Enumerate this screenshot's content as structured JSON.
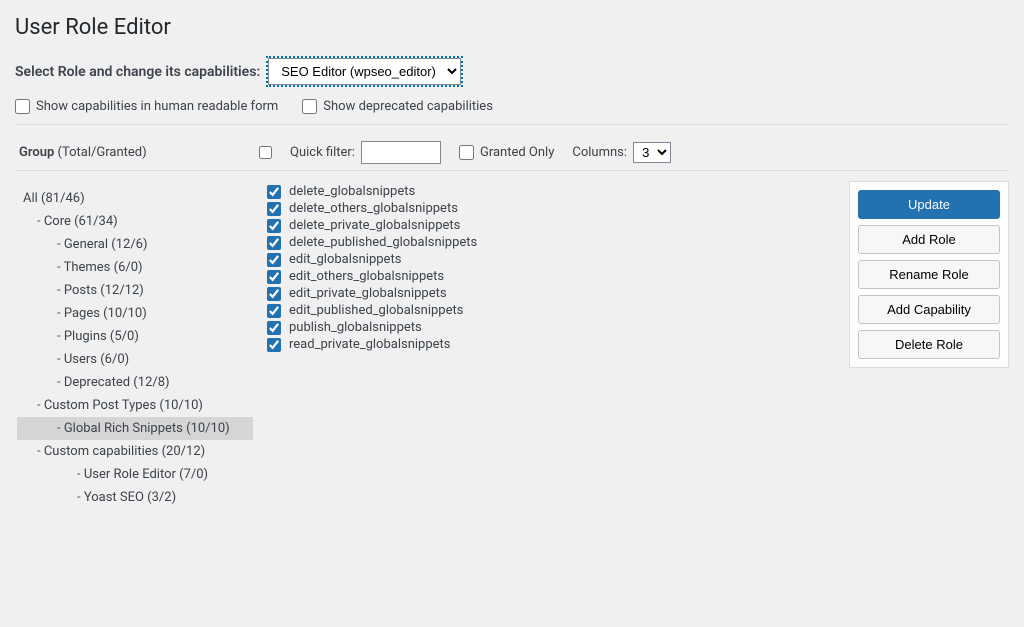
{
  "title": "User Role Editor",
  "roleSelect": {
    "label": "Select Role and change its capabilities:",
    "value": "SEO Editor (wpseo_editor)"
  },
  "options": {
    "humanReadable": "Show capabilities in human readable form",
    "deprecated": "Show deprecated capabilities"
  },
  "groupHeader": {
    "label": "Group",
    "suffix": "(Total/Granted)"
  },
  "filters": {
    "quickFilterLabel": "Quick filter:",
    "grantedOnly": "Granted Only",
    "columnsLabel": "Columns:",
    "columnsValue": "3"
  },
  "tree": [
    {
      "label": "All (81/46)",
      "level": 0
    },
    {
      "label": "Core (61/34)",
      "level": 1
    },
    {
      "label": "General (12/6)",
      "level": 2
    },
    {
      "label": "Themes (6/0)",
      "level": 2
    },
    {
      "label": "Posts (12/12)",
      "level": 2
    },
    {
      "label": "Pages (10/10)",
      "level": 2
    },
    {
      "label": "Plugins (5/0)",
      "level": 2
    },
    {
      "label": "Users (6/0)",
      "level": 2
    },
    {
      "label": "Deprecated (12/8)",
      "level": 2
    },
    {
      "label": "Custom Post Types (10/10)",
      "level": 1
    },
    {
      "label": "Global Rich Snippets (10/10)",
      "level": 2,
      "active": true
    },
    {
      "label": "Custom capabilities (20/12)",
      "level": 1
    },
    {
      "label": "User Role Editor (7/0)",
      "level": 3
    },
    {
      "label": "Yoast SEO (3/2)",
      "level": 3
    }
  ],
  "capabilities": [
    {
      "name": "delete_globalsnippets",
      "checked": true
    },
    {
      "name": "delete_others_globalsnippets",
      "checked": true
    },
    {
      "name": "delete_private_globalsnippets",
      "checked": true
    },
    {
      "name": "delete_published_globalsnippets",
      "checked": true
    },
    {
      "name": "edit_globalsnippets",
      "checked": true
    },
    {
      "name": "edit_others_globalsnippets",
      "checked": true
    },
    {
      "name": "edit_private_globalsnippets",
      "checked": true
    },
    {
      "name": "edit_published_globalsnippets",
      "checked": true
    },
    {
      "name": "publish_globalsnippets",
      "checked": true
    },
    {
      "name": "read_private_globalsnippets",
      "checked": true
    }
  ],
  "actions": {
    "update": "Update",
    "addRole": "Add Role",
    "renameRole": "Rename Role",
    "addCapability": "Add Capability",
    "deleteRole": "Delete Role"
  }
}
